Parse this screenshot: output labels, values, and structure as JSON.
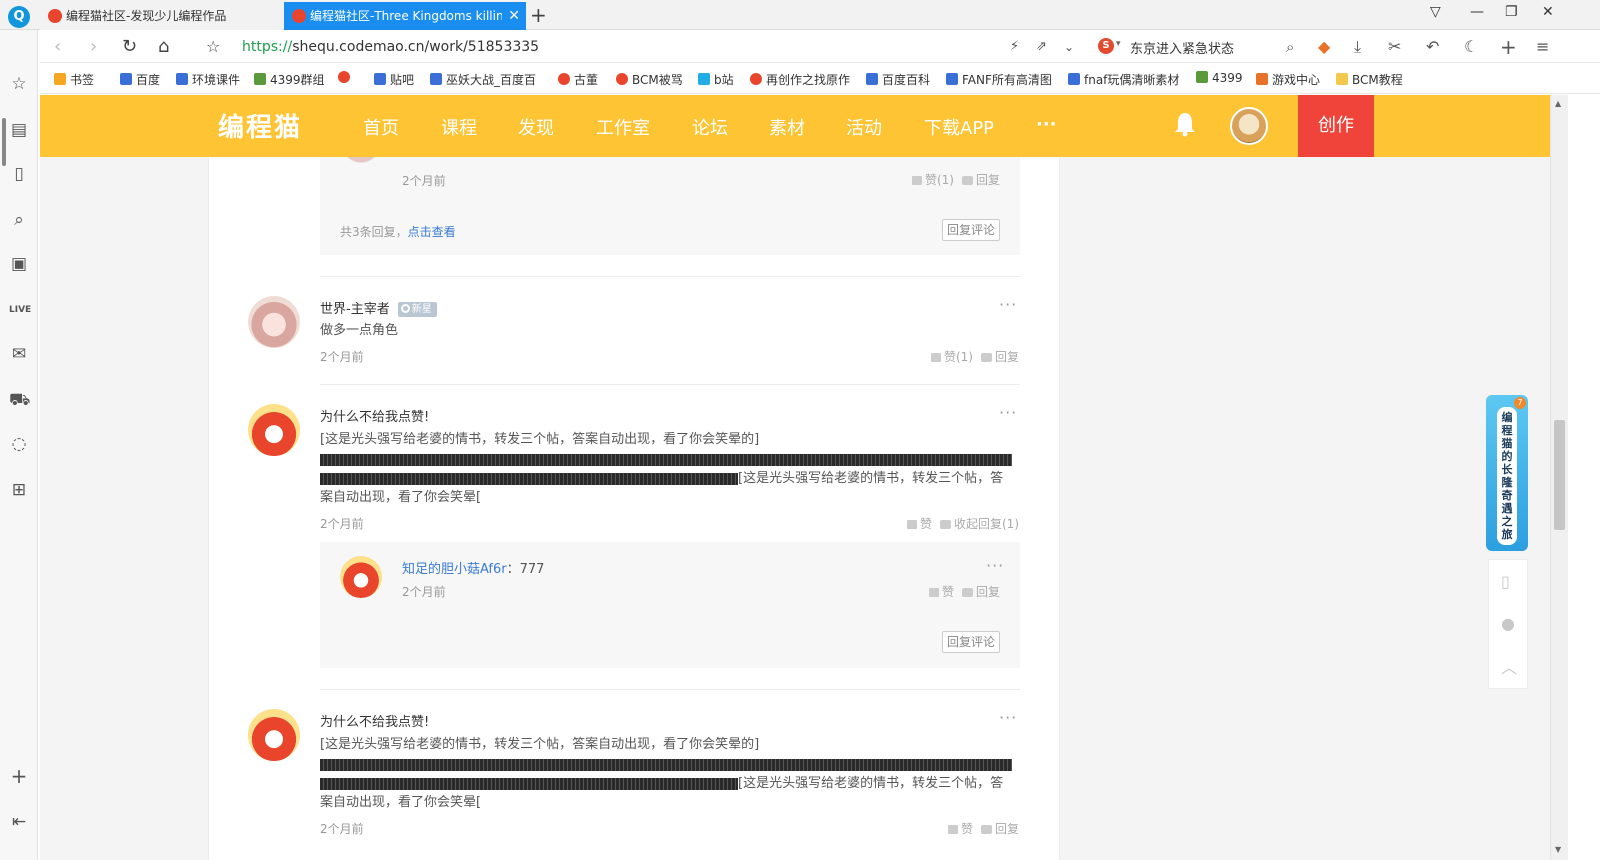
{
  "browser": {
    "tabs": [
      {
        "title": "编程猫社区-发现少儿编程作品",
        "active": false
      },
      {
        "title": "编程猫社区-Three Kingdoms killin",
        "active": true
      }
    ],
    "url_scheme": "https://",
    "url_rest": "shequ.codemao.cn/work/51853335",
    "search_text": "东京进入紧急状态",
    "bookmarks": [
      "书签",
      "百度",
      "环境课件",
      "4399群组",
      "贴吧",
      "巫妖大战_百度百",
      "古董",
      "BCM被骂",
      "b站",
      "再创作之找原作",
      "百度百科",
      "FANF所有高清图",
      "fnaf玩偶清晰素材",
      "4399",
      "游戏中心",
      "BCM教程"
    ]
  },
  "site": {
    "logo": "编程猫",
    "nav": [
      "首页",
      "课程",
      "发现",
      "工作室",
      "论坛",
      "素材",
      "活动",
      "下载APP",
      "···"
    ],
    "create": "创作"
  },
  "top_partial": {
    "time": "2个月前",
    "like": "赞(1)",
    "reply": "回复",
    "summary_prefix": "共3条回复，",
    "summary_link": "点击查看",
    "reply_comment": "回复评论"
  },
  "comments": [
    {
      "user": "世界-主宰者",
      "badge": "新星",
      "text": "做多一点角色",
      "time": "2个月前",
      "like": "赞(1)",
      "reply": "回复"
    },
    {
      "user": "为什么不给我点赞!",
      "text1": "[这是光头强写给老婆的情书，转发三个帖，答案自动出现，看了你会笑晕的]",
      "text2": "[这是光头强写给老婆的情书，转发三个帖，答",
      "text3": "案自动出现，看了你会笑晕[",
      "time": "2个月前",
      "like": "赞",
      "reply": "收起回复(1)",
      "subreply": {
        "user": "知足的胆小菇Af6r",
        "text": "：777",
        "time": "2个月前",
        "like": "赞",
        "reply": "回复",
        "reply_comment": "回复评论"
      }
    },
    {
      "user": "为什么不给我点赞!",
      "text1": "[这是光头强写给老婆的情书，转发三个帖，答案自动出现，看了你会笑晕的]",
      "text2": "[这是光头强写给老婆的情书，转发三个帖，答",
      "text3": "案自动出现，看了你会笑晕[",
      "time": "2个月前",
      "like": "赞",
      "reply": "回复"
    }
  ],
  "float_banner": "编程猫的长隆奇遇之旅",
  "float_badge": "7",
  "colors": {
    "brand": "#fec433",
    "create": "#f0433a",
    "tab_active": "#1a8ef0",
    "link": "#3a7bd5"
  }
}
